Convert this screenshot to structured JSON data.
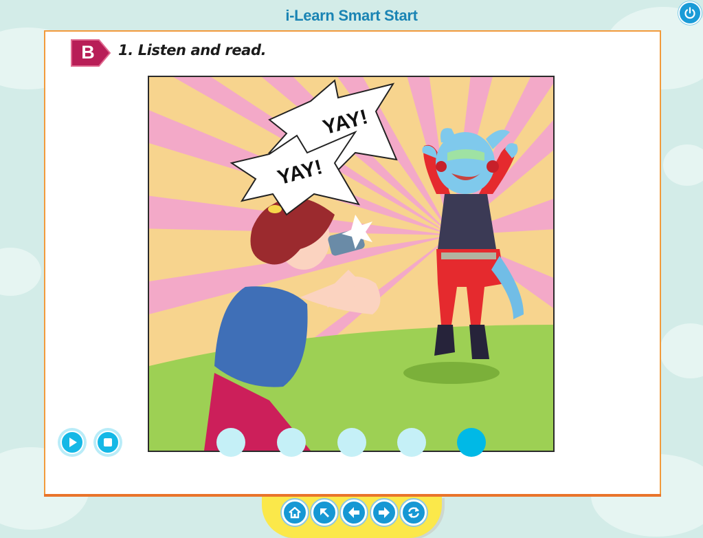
{
  "app": {
    "title": "i-Learn Smart Start"
  },
  "lesson": {
    "section_letter": "B",
    "instruction": "1. Listen and read.",
    "scene": {
      "speech_bubbles": [
        "YAY!",
        "YAY!"
      ],
      "icon": "comic-illustration"
    }
  },
  "controls": {
    "play_icon": "play-icon",
    "stop_icon": "stop-icon",
    "page_count": 5,
    "active_page": 5
  },
  "nav": {
    "buttons": [
      "home-icon",
      "arrow-up-left-icon",
      "arrow-left-icon",
      "arrow-right-icon",
      "refresh-icon"
    ]
  },
  "colors": {
    "accent": "#15b8e6",
    "brand_title": "#1a84b4",
    "panel_border": "#f29a3b",
    "badge": "#b81e57",
    "nav_tray": "#fbe84a"
  }
}
